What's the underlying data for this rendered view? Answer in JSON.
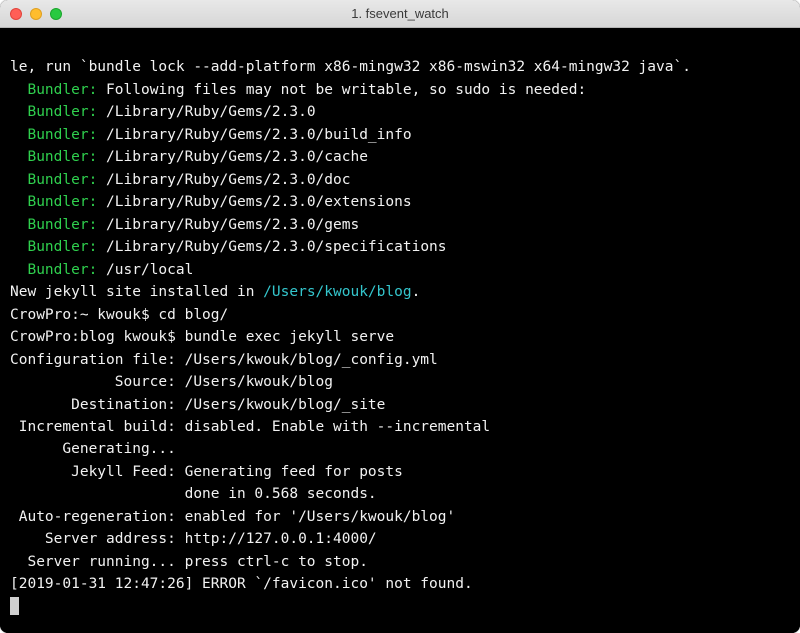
{
  "window": {
    "title": "1. fsevent_watch"
  },
  "colors": {
    "green": "#2fd04e",
    "cyan": "#34c6cd",
    "white": "#f2f2f2",
    "bg": "#000000"
  },
  "lines": {
    "l0": "le, run `bundle lock --add-platform x86-mingw32 x86-mswin32 x64-mingw32 java`.",
    "bundler_label": "Bundler:",
    "b1": " Following files may not be writable, so sudo is needed:",
    "b2": " /Library/Ruby/Gems/2.3.0",
    "b3": " /Library/Ruby/Gems/2.3.0/build_info",
    "b4": " /Library/Ruby/Gems/2.3.0/cache",
    "b5": " /Library/Ruby/Gems/2.3.0/doc",
    "b6": " /Library/Ruby/Gems/2.3.0/extensions",
    "b7": " /Library/Ruby/Gems/2.3.0/gems",
    "b8": " /Library/Ruby/Gems/2.3.0/specifications",
    "b9": " /usr/local",
    "installed_prefix": "New jekyll site installed in ",
    "installed_path": "/Users/kwouk/blog",
    "installed_suffix": ".",
    "prompt1": "CrowPro:~ kwouk$ cd blog/",
    "prompt2": "CrowPro:blog kwouk$ bundle exec jekyll serve",
    "config": "Configuration file: /Users/kwouk/blog/_config.yml",
    "source": "            Source: /Users/kwouk/blog",
    "dest": "       Destination: /Users/kwouk/blog/_site",
    "incr": " Incremental build: disabled. Enable with --incremental",
    "gen": "      Generating...",
    "feed": "       Jekyll Feed: Generating feed for posts",
    "done": "                    done in 0.568 seconds.",
    "autoregen": " Auto-regeneration: enabled for '/Users/kwouk/blog'",
    "addr": "    Server address: http://127.0.0.1:4000/",
    "running": "  Server running... press ctrl-c to stop.",
    "error": "[2019-01-31 12:47:26] ERROR `/favicon.ico' not found."
  }
}
